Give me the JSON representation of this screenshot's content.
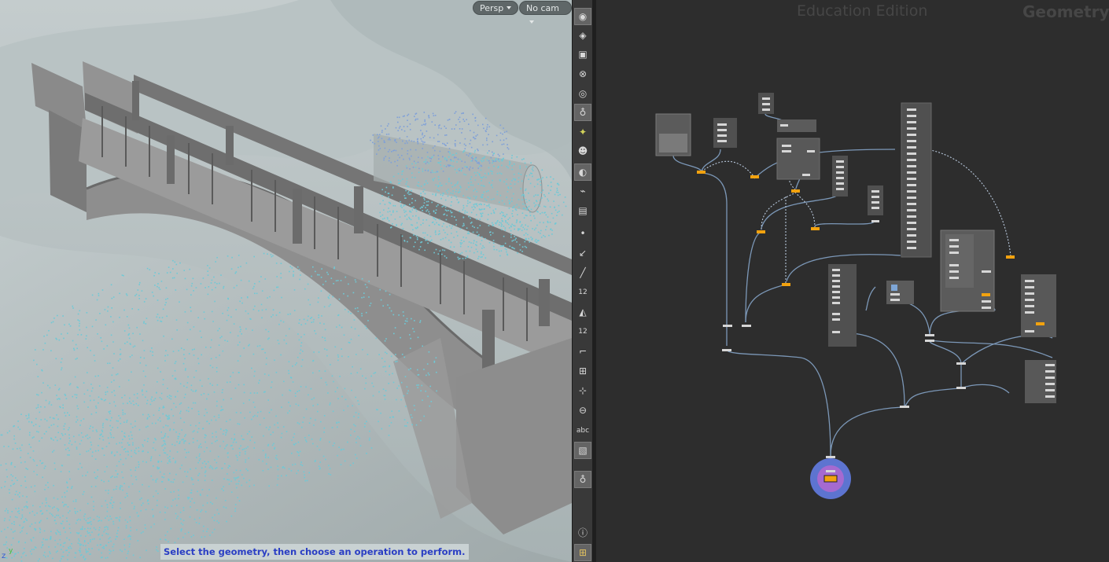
{
  "viewport": {
    "camera_mode": "Persp",
    "camera_select": "No cam",
    "status_message": "Select the geometry, then choose an operation to perform.",
    "axis_z": "z",
    "axis_y": "y"
  },
  "toolbar": {
    "items": [
      {
        "icon": "eye-visibility-icon",
        "active": true
      },
      {
        "icon": "display-options-icon",
        "active": false
      },
      {
        "icon": "lock-camera-icon",
        "active": false
      },
      {
        "icon": "light-off-icon",
        "active": false
      },
      {
        "icon": "headlight-icon",
        "active": false
      },
      {
        "icon": "bulb-icon",
        "active": true
      },
      {
        "icon": "bulb-green-icon",
        "active": false
      },
      {
        "icon": "skull-icon",
        "active": false
      },
      {
        "icon": "shading-mode-icon",
        "active": true
      },
      {
        "icon": "camera-link-icon",
        "active": false
      },
      {
        "icon": "camera-view-icon",
        "active": false
      },
      {
        "icon": "point-icon",
        "active": false
      },
      {
        "icon": "normal-icon",
        "active": false
      },
      {
        "icon": "pipette-icon",
        "active": false
      },
      {
        "icon": "point-numbers-icon",
        "label": "12",
        "active": false
      },
      {
        "icon": "primitive-display-icon",
        "active": false
      },
      {
        "icon": "primitive-numbers-icon",
        "label": "12",
        "active": false
      },
      {
        "icon": "corner-icon",
        "active": false
      },
      {
        "icon": "snap-grid-icon",
        "active": false
      },
      {
        "icon": "axis-handle-icon",
        "active": false
      },
      {
        "icon": "stop-icon",
        "active": false
      },
      {
        "icon": "text-abc-icon",
        "label": "abc",
        "active": false
      },
      {
        "icon": "background-image-icon",
        "active": true
      },
      {
        "icon": "flipbook-icon",
        "active": true
      },
      {
        "icon": "info-icon",
        "active": false
      },
      {
        "icon": "grid-layout-icon",
        "active": true
      }
    ]
  },
  "network": {
    "watermark_edition": "Education Edition",
    "watermark_context": "Geometry"
  },
  "colors": {
    "particle": "#6ec9d6",
    "node_flag": "#f2a20f",
    "output_ring": "#5d74d0",
    "output_node": "#a56ad0"
  }
}
